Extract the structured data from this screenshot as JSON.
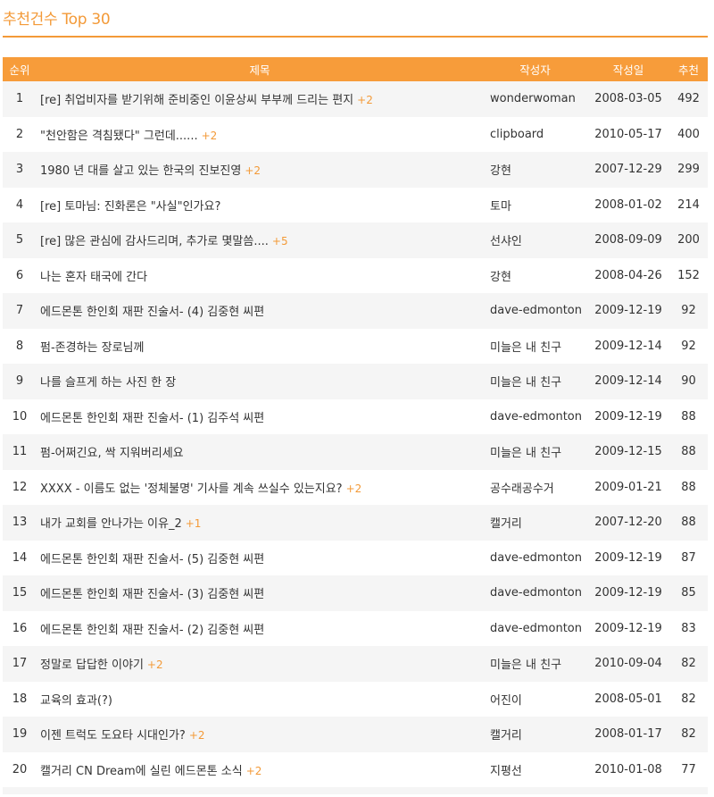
{
  "page": {
    "title": "추천건수 Top 30"
  },
  "table": {
    "headers": {
      "rank": "순위",
      "title": "제목",
      "author": "작성자",
      "date": "작성일",
      "recommend": "추천"
    },
    "rows": [
      {
        "rank": "1",
        "title": "[re] 취업비자를 받기위해 준비중인 이윤상씨 부부께 드리는 편지",
        "comments": "+2",
        "author": "wonderwoman",
        "date": "2008-03-05",
        "recommend": "492"
      },
      {
        "rank": "2",
        "title": "\"천안함은 격침됐다\" 그런데......",
        "comments": "+2",
        "author": "clipboard",
        "date": "2010-05-17",
        "recommend": "400"
      },
      {
        "rank": "3",
        "title": "1980 년 대를 살고 있는 한국의 진보진영",
        "comments": "+2",
        "author": "강현",
        "date": "2007-12-29",
        "recommend": "299"
      },
      {
        "rank": "4",
        "title": "[re] 토마님: 진화론은 \"사실\"인가요?",
        "comments": "",
        "author": "토마",
        "date": "2008-01-02",
        "recommend": "214"
      },
      {
        "rank": "5",
        "title": "[re] 많은 관심에 감사드리며, 추가로 몇말씀....",
        "comments": "+5",
        "author": "선샤인",
        "date": "2008-09-09",
        "recommend": "200"
      },
      {
        "rank": "6",
        "title": "나는 혼자 태국에 간다",
        "comments": "",
        "author": "강현",
        "date": "2008-04-26",
        "recommend": "152"
      },
      {
        "rank": "7",
        "title": "에드몬톤 한인회 재판 진술서- (4) 김중현 씨편",
        "comments": "",
        "author": "dave-edmonton",
        "date": "2009-12-19",
        "recommend": "92"
      },
      {
        "rank": "8",
        "title": "펌-존경하는 장로님께",
        "comments": "",
        "author": "미늘은 내 친구",
        "date": "2009-12-14",
        "recommend": "92"
      },
      {
        "rank": "9",
        "title": "나를 슬프게 하는 사진 한 장",
        "comments": "",
        "author": "미늘은 내 친구",
        "date": "2009-12-14",
        "recommend": "90"
      },
      {
        "rank": "10",
        "title": "에드몬톤 한인회 재판 진술서- (1) 김주석 씨편",
        "comments": "",
        "author": "dave-edmonton",
        "date": "2009-12-19",
        "recommend": "88"
      },
      {
        "rank": "11",
        "title": "펌-어쩌긴요, 싹 지워버리세요",
        "comments": "",
        "author": "미늘은 내 친구",
        "date": "2009-12-15",
        "recommend": "88"
      },
      {
        "rank": "12",
        "title": "XXXX - 이름도 없는 '정체불명' 기사를 계속 쓰실수 있는지요?",
        "comments": "+2",
        "author": "공수래공수거",
        "date": "2009-01-21",
        "recommend": "88"
      },
      {
        "rank": "13",
        "title": "내가 교회를 안나가는 이유_2",
        "comments": "+1",
        "author": "캘거리",
        "date": "2007-12-20",
        "recommend": "88"
      },
      {
        "rank": "14",
        "title": "에드몬톤 한인회 재판 진술서- (5) 김중현 씨편",
        "comments": "",
        "author": "dave-edmonton",
        "date": "2009-12-19",
        "recommend": "87"
      },
      {
        "rank": "15",
        "title": "에드몬톤 한인회 재판 진술서- (3) 김중현 씨편",
        "comments": "",
        "author": "dave-edmonton",
        "date": "2009-12-19",
        "recommend": "85"
      },
      {
        "rank": "16",
        "title": "에드몬톤 한인회 재판 진술서- (2) 김중현 씨편",
        "comments": "",
        "author": "dave-edmonton",
        "date": "2009-12-19",
        "recommend": "83"
      },
      {
        "rank": "17",
        "title": "정말로 답답한 이야기",
        "comments": "+2",
        "author": "미늘은 내 친구",
        "date": "2010-09-04",
        "recommend": "82"
      },
      {
        "rank": "18",
        "title": "교육의 효과(?)",
        "comments": "",
        "author": "어진이",
        "date": "2008-05-01",
        "recommend": "82"
      },
      {
        "rank": "19",
        "title": "이젠 트럭도 도요타 시대인가?",
        "comments": "+2",
        "author": "캘거리",
        "date": "2008-01-17",
        "recommend": "82"
      },
      {
        "rank": "20",
        "title": "캘거리 CN Dream에 실린 에드몬톤 소식",
        "comments": "+2",
        "author": "지평선",
        "date": "2010-01-08",
        "recommend": "77"
      }
    ]
  },
  "colors": {
    "accent": "#f39a38",
    "header_bg": "#f79c3a",
    "row_alt": "#f5f5f5"
  }
}
